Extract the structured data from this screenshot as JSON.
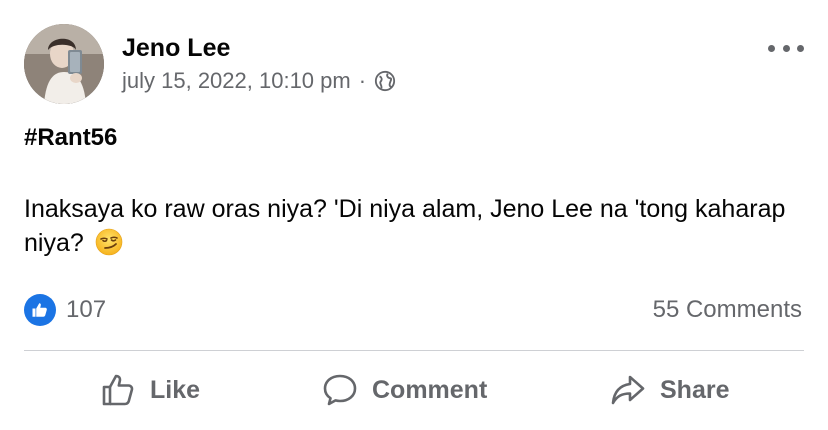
{
  "post": {
    "author": "Jeno Lee",
    "timestamp": "july 15, 2022, 10:10 pm",
    "separator": "·",
    "audience_icon": "globe-icon",
    "hashtag": "#Rant56",
    "text": "Inaksaya ko raw oras niya? 'Di niya alam, Jeno Lee na 'tong kaharap niya?",
    "emoji": "smirk-emoji"
  },
  "stats": {
    "like_count": "107",
    "comments": "55 Comments"
  },
  "actions": {
    "like": "Like",
    "comment": "Comment",
    "share": "Share"
  },
  "colors": {
    "accent": "#1b74e4",
    "secondary_text": "#65676b",
    "divider": "#ced0d4"
  }
}
